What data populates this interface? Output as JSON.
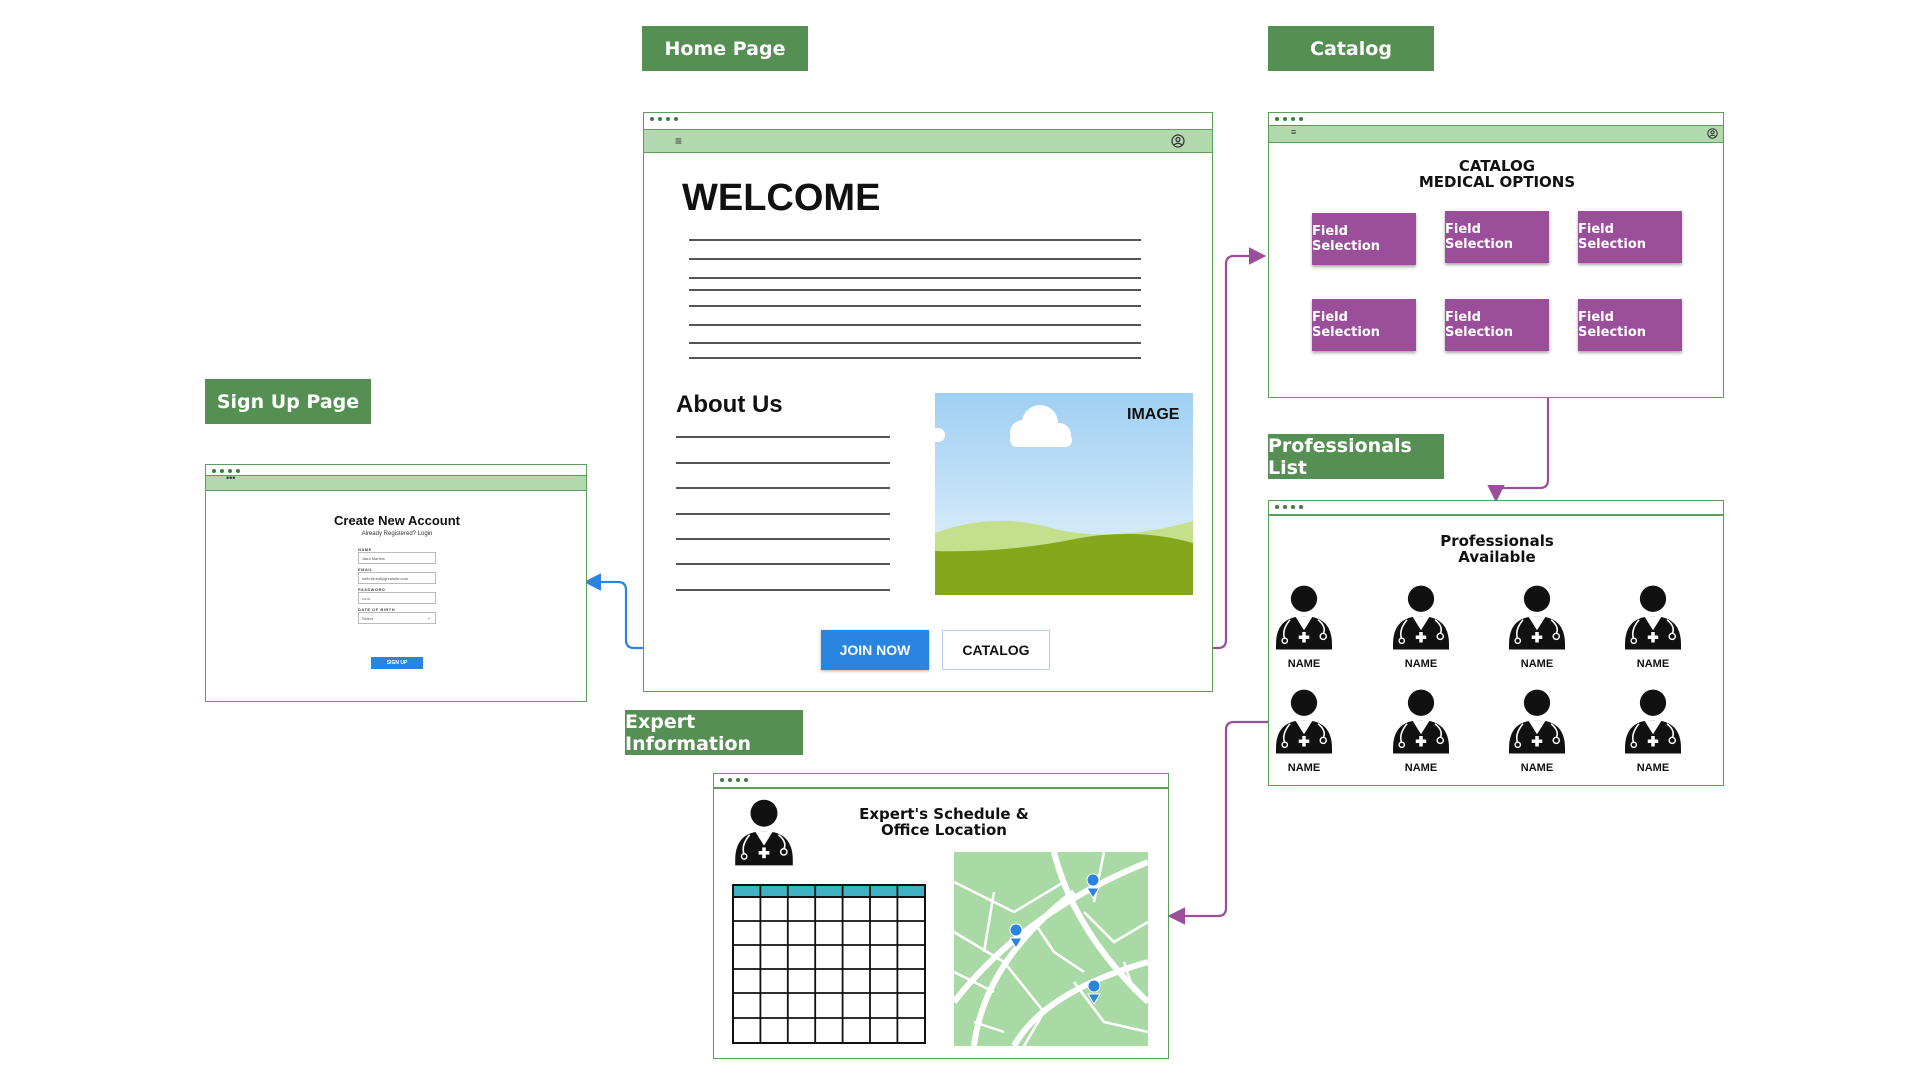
{
  "labels": {
    "home": "Home Page",
    "catalog": "Catalog",
    "signup": "Sign Up Page",
    "professionals": "Professionals List",
    "expert": "Expert Information"
  },
  "home": {
    "welcome": "WELCOME",
    "about": "About Us",
    "image": "IMAGE",
    "join": "JOIN NOW",
    "catalog_btn": "CATALOG"
  },
  "catalog": {
    "title1": "CATALOG",
    "title2": "MEDICAL OPTIONS",
    "fields": [
      "Field Selection",
      "Field Selection",
      "Field Selection",
      "Field Selection",
      "Field Selection",
      "Field Selection"
    ]
  },
  "signup": {
    "title": "Create New Account",
    "sub": "Already Registered? Login",
    "name_label": "NAME",
    "name_value": "Jiara Martins",
    "email_label": "EMAIL",
    "email_value": "hello@reallygreatsite.com",
    "password_label": "PASSWORD",
    "password_value": "••••••",
    "dob_label": "DATE OF BIRTH",
    "dob_value": "Select",
    "button": "SIGN UP"
  },
  "professionals": {
    "title1": "Professionals",
    "title2": "Available",
    "names": [
      "NAME",
      "NAME",
      "NAME",
      "NAME",
      "NAME",
      "NAME",
      "NAME",
      "NAME"
    ]
  },
  "expert": {
    "title1": "Expert's Schedule &",
    "title2": "Office Location"
  },
  "colors": {
    "tag_green": "#568f54",
    "bar_green": "#b2d9ae",
    "purple": "#9b4f9b",
    "blue": "#2a85e0",
    "teal": "#3fb3c3"
  }
}
